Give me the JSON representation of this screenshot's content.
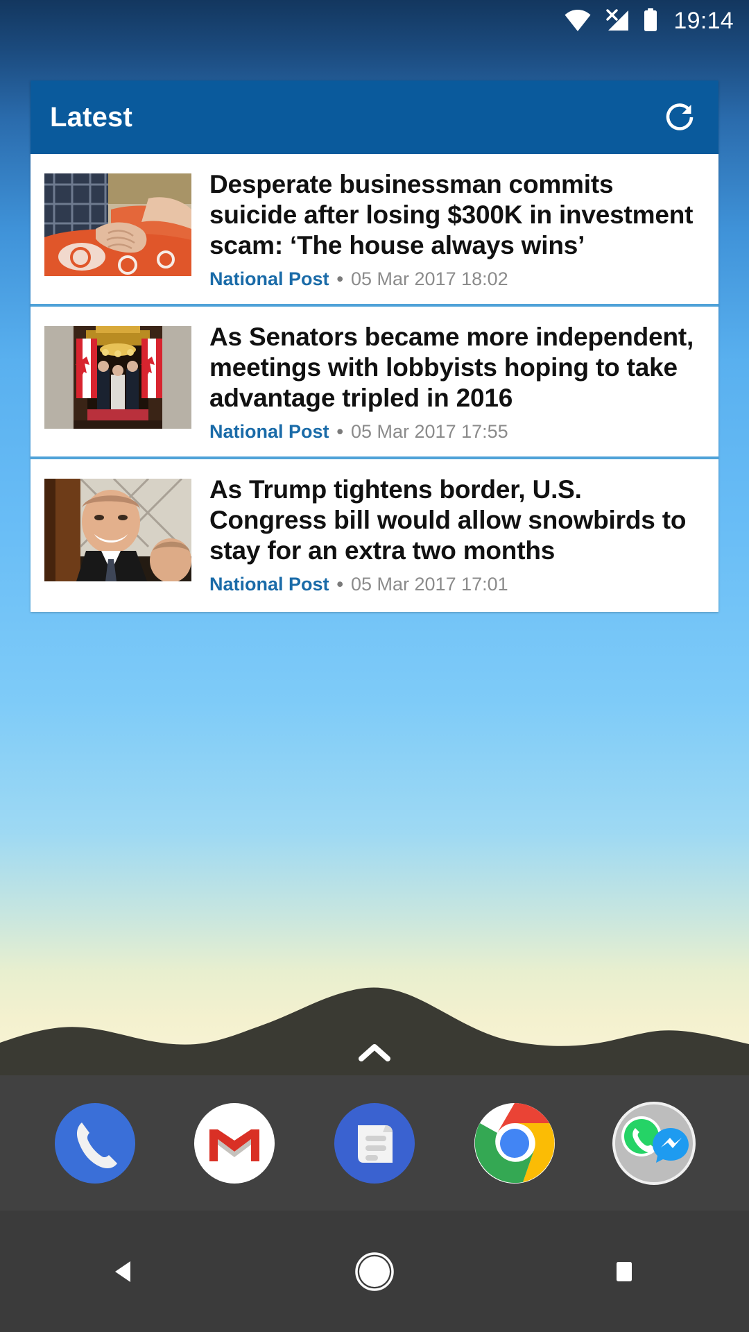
{
  "status_bar": {
    "time": "19:14",
    "icons": [
      {
        "name": "wifi-icon",
        "label": "Wi-Fi connected"
      },
      {
        "name": "cellular-no-sim-icon",
        "label": "No SIM / no signal"
      },
      {
        "name": "battery-icon",
        "label": "Battery"
      }
    ]
  },
  "widget": {
    "title": "Latest",
    "refresh_label": "Refresh",
    "header_color": "#0a5a9c",
    "separator_color": "#4fa2d8",
    "source_color": "#1a6ba8",
    "items": [
      {
        "headline": "Desperate businessman commits suicide after losing $300K in investment scam: ‘The house always wins’",
        "source": "National Post",
        "separator": "•",
        "timestamp": "05 Mar 2017 18:02",
        "thumbnail_alt": "Two hands clasped over an orange blanket"
      },
      {
        "headline": "As Senators became more independent, meetings with lobbyists hoping to take advantage tripled in 2016",
        "source": "National Post",
        "separator": "•",
        "timestamp": "05 Mar 2017 17:55",
        "thumbnail_alt": "People standing between two Canadian flags in a stone archway"
      },
      {
        "headline": "As Trump tightens border, U.S. Congress bill would allow snowbirds to stay for an extra two months",
        "source": "National Post",
        "separator": "•",
        "timestamp": "05 Mar 2017 17:01",
        "thumbnail_alt": "Smiling man in a dark suit in front of a lattice window"
      }
    ]
  },
  "home_screen": {
    "app_drawer_handle": "Open app drawer",
    "dock": [
      {
        "name": "phone",
        "label": "Phone"
      },
      {
        "name": "gmail",
        "label": "Gmail"
      },
      {
        "name": "messages",
        "label": "Messages"
      },
      {
        "name": "chrome",
        "label": "Chrome"
      },
      {
        "name": "chat-folder",
        "label": "WhatsApp and Messenger folder"
      }
    ]
  },
  "nav_bar": {
    "buttons": [
      {
        "name": "back",
        "label": "Back"
      },
      {
        "name": "home",
        "label": "Home"
      },
      {
        "name": "recents",
        "label": "Recent apps"
      }
    ]
  }
}
